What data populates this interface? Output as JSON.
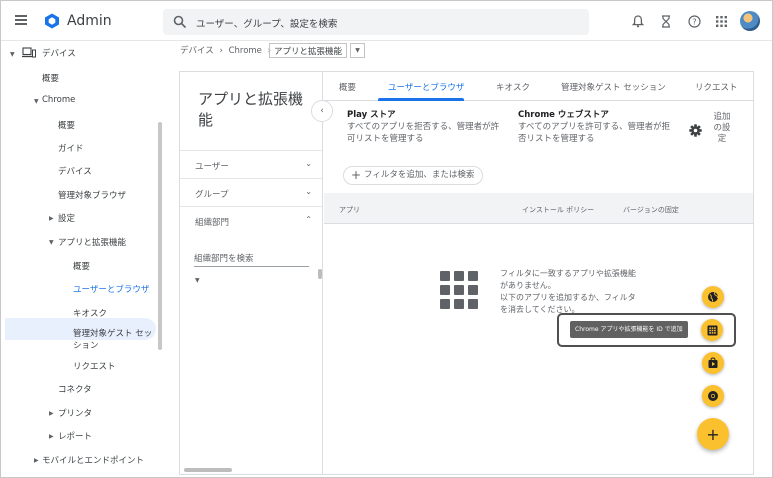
{
  "header": {
    "app_title": "Admin",
    "search_placeholder": "ユーザー、グループ、設定を検索",
    "icons": [
      "bell-icon",
      "hourglass-icon",
      "help-icon",
      "apps-grid-icon",
      "avatar"
    ]
  },
  "sidebar": {
    "items": [
      {
        "label": "デバイス",
        "level": 0,
        "expanded": true
      },
      {
        "label": "概要",
        "level": 1
      },
      {
        "label": "Chrome",
        "level": 1,
        "expanded": true
      },
      {
        "label": "概要",
        "level": 2
      },
      {
        "label": "ガイド",
        "level": 2
      },
      {
        "label": "デバイス",
        "level": 2
      },
      {
        "label": "管理対象ブラウザ",
        "level": 2
      },
      {
        "label": "設定",
        "level": 2,
        "collapsed": true
      },
      {
        "label": "アプリと拡張機能",
        "level": 2,
        "expanded": true
      },
      {
        "label": "概要",
        "level": 3
      },
      {
        "label": "ユーザーとブラウザ",
        "level": 3,
        "active": true
      },
      {
        "label": "キオスク",
        "level": 3
      },
      {
        "label": "管理対象ゲスト セッ",
        "label2": "ション",
        "level": 3
      },
      {
        "label": "リクエスト",
        "level": 3
      },
      {
        "label": "コネクタ",
        "level": 2
      },
      {
        "label": "プリンタ",
        "level": 2,
        "collapsed": true
      },
      {
        "label": "レポート",
        "level": 2,
        "collapsed": true
      },
      {
        "label": "モバイルとエンドポイント",
        "level": 1,
        "collapsed": true
      }
    ]
  },
  "breadcrumb": {
    "part1": "デバイス",
    "sep": "›",
    "part2": "Chrome",
    "current": "アプリと拡張機能"
  },
  "filter_panel": {
    "title_line1": "アプリと拡張機",
    "title_line2": "能",
    "users_label": "ユーザー",
    "groups_label": "グループ",
    "org_label": "組織部門",
    "org_search_placeholder": "組織部門を検索"
  },
  "tabs": [
    {
      "label": "概要"
    },
    {
      "label": "ユーザーとブラウザ",
      "active": true
    },
    {
      "label": "キオスク"
    },
    {
      "label": "管理対象ゲスト セッション"
    },
    {
      "label": "リクエスト"
    }
  ],
  "settings": {
    "play_title": "Play ストア",
    "play_desc1": "すべてのアプリを拒否する、管理者が許",
    "play_desc2": "可リストを管理する",
    "webstore_title": "Chrome ウェブストア",
    "webstore_desc1": "すべてのアプリを許可する、管理者が拒",
    "webstore_desc2": "否リストを管理する",
    "add_settings_line1": "追加",
    "add_settings_line2": "の設",
    "add_settings_line3": "定"
  },
  "filter_chip": "フィルタを追加、または検索",
  "table": {
    "columns": [
      "アプリ",
      "インストール ポリシー",
      "バージョンの固定"
    ]
  },
  "empty_state": {
    "line1": "フィルタに一致するアプリや拡張機能",
    "line2": "がありません。",
    "line3": "以下のアプリを追加するか、フィルタ",
    "line4": "を消去してください。"
  },
  "fab": {
    "tooltip": "Chrome アプリや拡張機能を ID で追加",
    "plus": "+"
  },
  "colors": {
    "accent": "#1a73e8",
    "fab": "#fbc02d",
    "active_bg": "#e8f0fe"
  }
}
